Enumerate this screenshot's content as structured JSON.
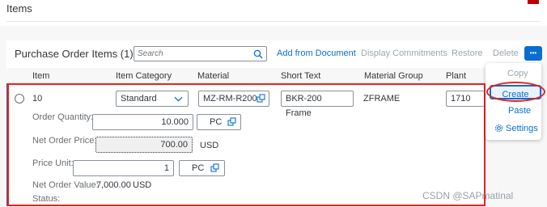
{
  "page": {
    "title": "Items"
  },
  "table": {
    "title": "Purchase Order Items (1)",
    "search": {
      "placeholder": "Search"
    },
    "toolbar": {
      "add_from_document": "Add from Document",
      "display_commitments": "Display Commitments",
      "restore": "Restore",
      "delete": "Delete",
      "more": "•••"
    },
    "columns": [
      "Item",
      "Item Category",
      "Material",
      "Short Text",
      "Material Group",
      "Plant"
    ],
    "row": {
      "item": "10",
      "item_category": "Standard",
      "material": "MZ-RM-R200",
      "short_text": "BKR-200 Frame",
      "material_group": "ZFRAME",
      "plant": "1710"
    },
    "details": {
      "order_quantity_label": "Order Quantity:",
      "order_quantity_value": "10.000",
      "order_quantity_unit": "PC",
      "net_order_price_label": "Net Order Price:",
      "net_order_price_value": "700.00",
      "net_order_price_currency": "USD",
      "price_unit_label": "Price Unit:",
      "price_unit_value": "1",
      "price_unit_unit": "PC",
      "net_order_value_label": "Net Order Value:",
      "net_order_value_value": "7,000.00",
      "net_order_value_currency": "USD",
      "status_label": "Status:"
    }
  },
  "menu": {
    "copy": "Copy",
    "create": "Create",
    "paste": "Paste",
    "settings": "Settings"
  },
  "watermark": "CSDN @SAPmatinal",
  "colors": {
    "accent": "#0a6ed1",
    "annotation_red": "#e8211f",
    "text": "#32363a",
    "muted": "#6a6d70"
  }
}
